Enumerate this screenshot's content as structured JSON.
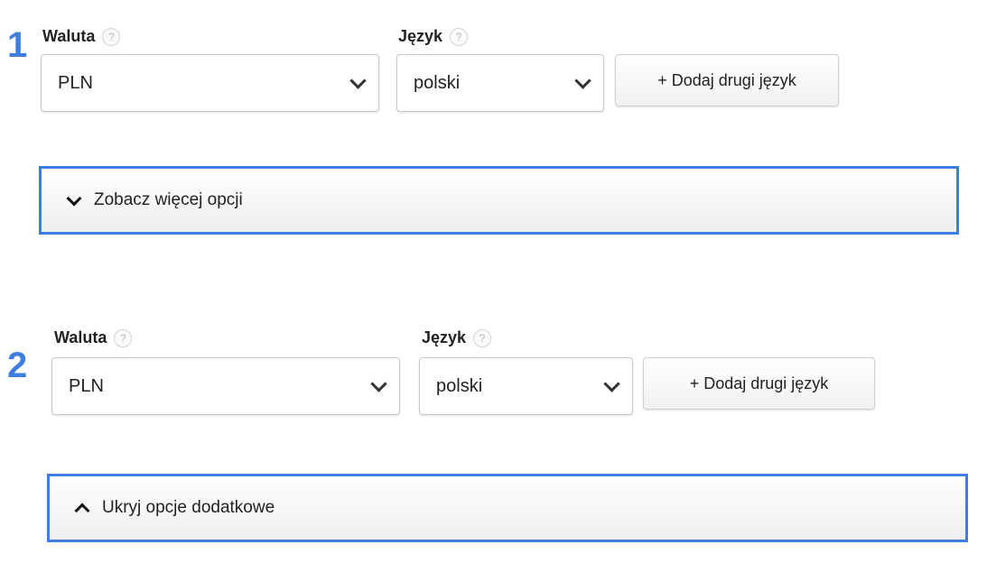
{
  "sections": [
    {
      "step": "1",
      "currency": {
        "label": "Waluta",
        "help": "?",
        "value": "PLN"
      },
      "language": {
        "label": "Język",
        "help": "?",
        "value": "polski"
      },
      "add_language_button": "+ Dodaj drugi język",
      "toggle": {
        "label": "Zobacz więcej opcji",
        "icon": "chevron-down-icon"
      }
    },
    {
      "step": "2",
      "currency": {
        "label": "Waluta",
        "help": "?",
        "value": "PLN"
      },
      "language": {
        "label": "Język",
        "help": "?",
        "value": "polski"
      },
      "add_language_button": "+ Dodaj drugi język",
      "toggle": {
        "label": "Ukryj opcje dodatkowe",
        "icon": "chevron-up-icon"
      }
    }
  ],
  "colors": {
    "step_number": "#3f7ee0",
    "toggle_border": "#3f7ee0"
  }
}
